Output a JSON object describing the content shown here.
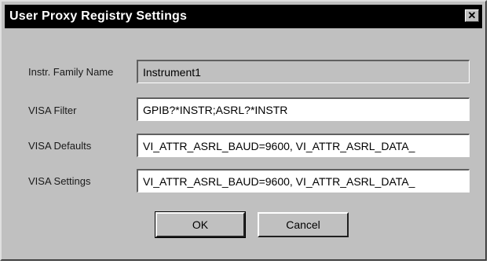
{
  "window": {
    "title": "User Proxy Registry Settings",
    "close_glyph": "✕"
  },
  "form": {
    "family_label": "Instr. Family Name",
    "family_value": "Instrument1",
    "filter_label": "VISA Filter",
    "filter_value": "GPIB?*INSTR;ASRL?*INSTR",
    "defaults_label": "VISA Defaults",
    "defaults_value": "VI_ATTR_ASRL_BAUD=9600, VI_ATTR_ASRL_DATA_",
    "settings_label": "VISA Settings",
    "settings_value": "VI_ATTR_ASRL_BAUD=9600, VI_ATTR_ASRL_DATA_"
  },
  "buttons": {
    "ok_label": "OK",
    "cancel_label": "Cancel"
  }
}
